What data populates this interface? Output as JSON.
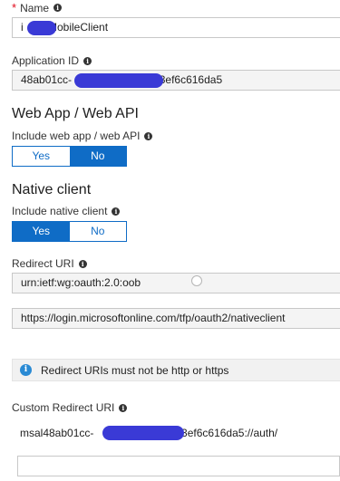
{
  "name_field": {
    "label": "Name",
    "required_mark": "*",
    "value_prefix": "i",
    "value_suffix": "/MobileClient"
  },
  "application_id": {
    "label": "Application ID",
    "value_prefix": "48ab01cc-",
    "value_suffix": "73ef6c616da5"
  },
  "web_app": {
    "heading": "Web App / Web API",
    "include_label": "Include web app / web API",
    "options": [
      "Yes",
      "No"
    ],
    "selected": "No"
  },
  "native_client": {
    "heading": "Native client",
    "include_label": "Include native client",
    "options": [
      "Yes",
      "No"
    ],
    "selected": "Yes"
  },
  "redirect_uri": {
    "label": "Redirect URI",
    "values": [
      "urn:ietf:wg:oauth:2.0:oob",
      "https://login.microsoftonline.com/tfp/oauth2/nativeclient"
    ]
  },
  "info_banner": {
    "icon": "info-icon",
    "text": "Redirect URIs must not be http or https"
  },
  "custom_redirect_uri": {
    "label": "Custom Redirect URI",
    "value_prefix": "msal48ab01cc-",
    "value_suffix": "73ef6c616da5://auth/",
    "empty_value": ""
  },
  "colors": {
    "accent": "#0f6cc6",
    "required": "#e00b1c",
    "redaction": "#3a3ad6",
    "info_icon": "#2a8ad4"
  }
}
